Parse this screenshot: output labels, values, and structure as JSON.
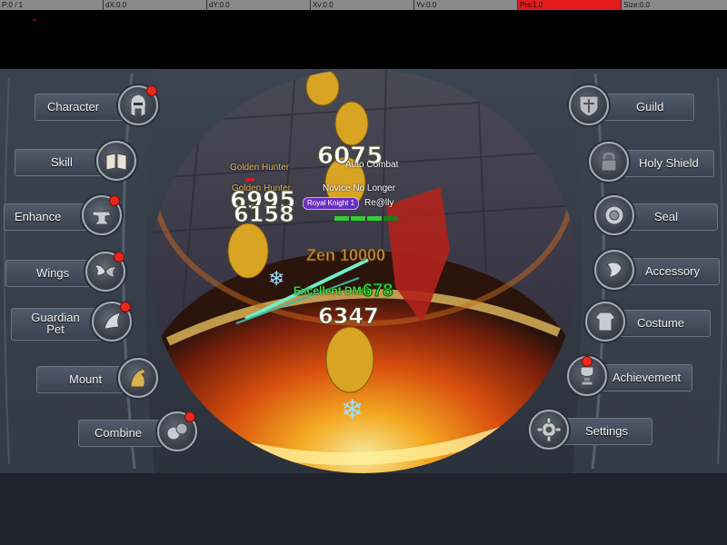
{
  "debug_bar": {
    "p": "P:0 / 1",
    "dx": "dX:0.0",
    "dy": "dY:0.0",
    "xv": "Xv:0.0",
    "yv": "Yv:0.0",
    "prs": "Prs:1.0",
    "size": "Size:0.0"
  },
  "left_menu": [
    {
      "label": "Character",
      "icon": "helmet-icon",
      "badge": true
    },
    {
      "label": "Skill",
      "icon": "book-icon",
      "badge": false
    },
    {
      "label": "Enhance",
      "icon": "anvil-icon",
      "badge": true
    },
    {
      "label": "Wings",
      "icon": "wings-icon",
      "badge": true
    },
    {
      "label": "Guardian Pet",
      "icon": "guardian-pet-icon",
      "badge": true
    },
    {
      "label": "Mount",
      "icon": "mount-icon",
      "badge": false
    },
    {
      "label": "Combine",
      "icon": "combine-icon",
      "badge": true
    }
  ],
  "right_menu": [
    {
      "label": "Guild",
      "icon": "guild-crest-icon",
      "badge": false
    },
    {
      "label": "Holy Shield",
      "icon": "lock-icon",
      "badge": false
    },
    {
      "label": "Seal",
      "icon": "seal-icon",
      "badge": false
    },
    {
      "label": "Accessory",
      "icon": "accessory-icon",
      "badge": false
    },
    {
      "label": "Costume",
      "icon": "costume-icon",
      "badge": false
    },
    {
      "label": "Achievement",
      "icon": "achievement-icon",
      "badge": true
    },
    {
      "label": "Settings",
      "icon": "gear-icon",
      "badge": false
    }
  ],
  "scene": {
    "enemy_name_1": "Golden Hunter",
    "enemy_name_2": "Golden Hunter",
    "damage_1": "6075",
    "damage_2": "6995",
    "damage_3": "6158",
    "damage_4": "6347",
    "heal": "678",
    "auto_combat": "Auto Combat",
    "player_title": "Novice No Longer",
    "player_rank": "Royal Knight 1",
    "player_name": "Re@lly",
    "miss_text": "Zen 10000",
    "excellent_text": "Excellent DMG"
  },
  "colors": {
    "badge": "#e8281e",
    "prs_highlight": "#e31b1b",
    "damage_text": "#ffffff",
    "heal_text": "#3be03b",
    "enemy_name": "#e7b25a"
  }
}
